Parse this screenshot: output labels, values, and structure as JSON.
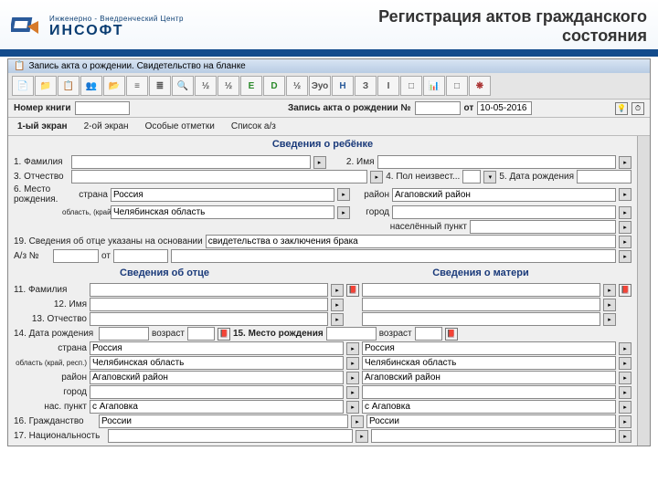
{
  "header": {
    "logo_line1": "Инженерно - Внедренческий Центр",
    "logo_line2": "ИНСОФТ",
    "title_l1": "Регистрация актов гражданского",
    "title_l2": "состояния"
  },
  "window": {
    "title": "Запись акта о рождении.  Свидетельство на бланке"
  },
  "toolbar": {
    "icons": [
      "📄",
      "📁",
      "📋",
      "👥",
      "📂",
      "≡",
      "≣",
      "🔍",
      "½",
      "½",
      "E",
      "D",
      "½",
      "Эуо",
      "Н",
      "З",
      "I",
      "□",
      "📊",
      "□",
      "❋"
    ]
  },
  "head_row": {
    "book_no": "Номер книги",
    "act_label": "Запись акта о рождении №",
    "from": "от",
    "date": "10-05-2016"
  },
  "tabs": [
    "1-ый экран",
    "2-ой экран",
    "Особые отметки",
    "Список а/з"
  ],
  "section1": "Сведения о ребёнке",
  "child": {
    "f1": "1. Фамилия",
    "f2": "2. Имя",
    "f3": "3. Отчество",
    "f4": "4. Пол неизвест...",
    "f5": "5. Дата рождения",
    "f6": "6. Место",
    "f6b": "рождения.",
    "country": "страна",
    "country_v": "Россия",
    "region": "область,\n(край, респ.)",
    "region_v": "Челябинская область",
    "district": "район",
    "district_v": "Агаповский район",
    "city": "город",
    "settlement": "населённый пункт"
  },
  "row19": "19. Сведения об отце указаны на основании",
  "row19_v": "свидетельства о заключения брака",
  "az": "А/з №",
  "az_from": "от",
  "father_hdr": "Сведения об отце",
  "mother_hdr": "Сведения о матери",
  "pf": {
    "f11": "11. Фамилия",
    "f12": "12. Имя",
    "f13": "13. Отчество",
    "f14": "14. Дата рождения",
    "age": "возраст",
    "f15": "15. Место рождения"
  },
  "place": {
    "country": "страна",
    "country_v": "Россия",
    "region": "область\n(край, респ.)",
    "region_v": "Челябинская область",
    "district": "район",
    "district_v": "Агаповский район",
    "city": "город",
    "settlement": "нас. пункт",
    "settlement_v": "с Агаповка"
  },
  "f16": "16. Гражданство",
  "f16_v": "России",
  "f17": "17. Национальность"
}
